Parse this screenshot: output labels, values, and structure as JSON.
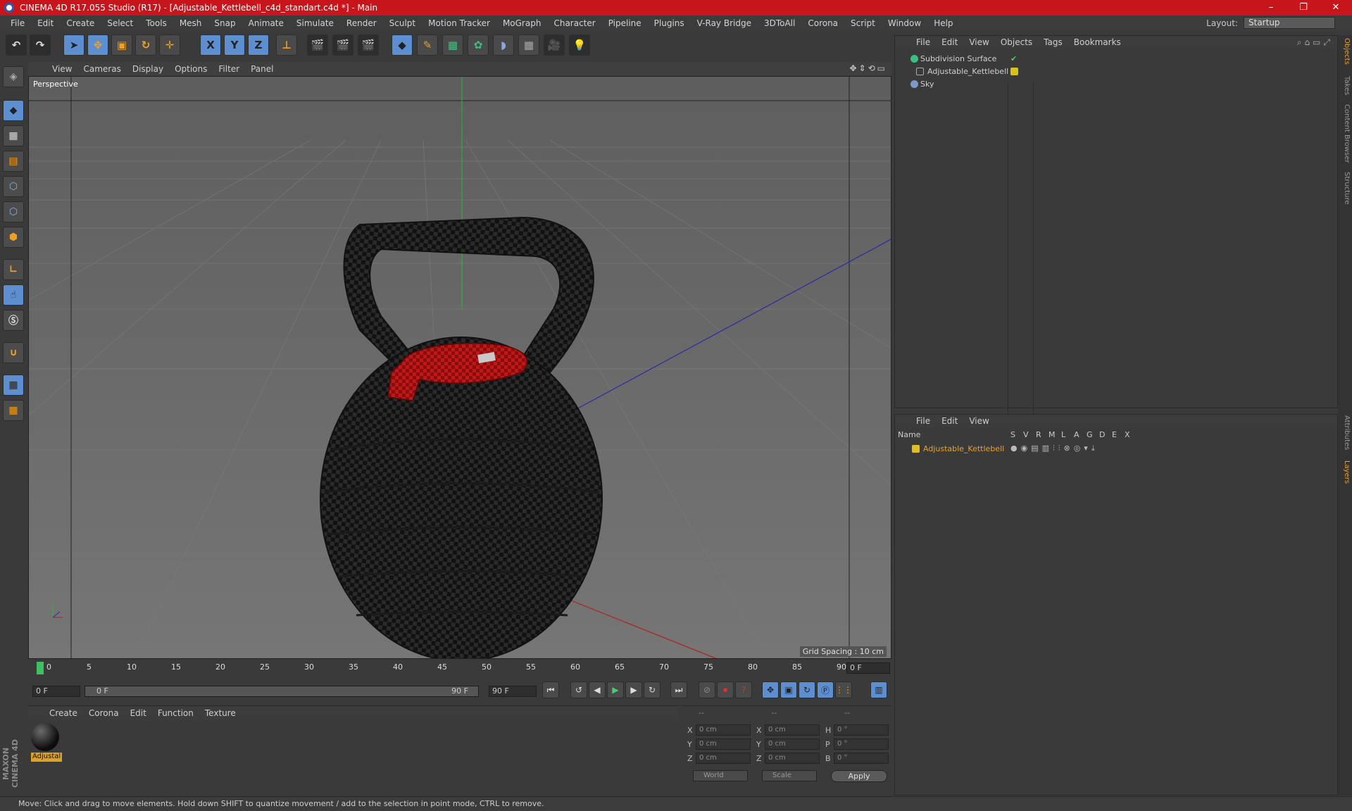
{
  "window": {
    "title": "CINEMA 4D R17.055 Studio (R17) - [Adjustable_Kettlebell_c4d_standart.c4d *] - Main",
    "controls": [
      "–",
      "❐",
      "✕"
    ]
  },
  "menubar": {
    "items": [
      "File",
      "Edit",
      "Create",
      "Select",
      "Tools",
      "Mesh",
      "Snap",
      "Animate",
      "Simulate",
      "Render",
      "Sculpt",
      "Motion Tracker",
      "MoGraph",
      "Character",
      "Pipeline",
      "Plugins",
      "V-Ray Bridge",
      "3DToAll",
      "Corona",
      "Script",
      "Window",
      "Help"
    ],
    "layout_label": "Layout:",
    "layout_value": "Startup"
  },
  "toolbar": {
    "axis_x": "X",
    "axis_y": "Y",
    "axis_z": "Z"
  },
  "viewport": {
    "menu": [
      "View",
      "Cameras",
      "Display",
      "Options",
      "Filter",
      "Panel"
    ],
    "label": "Perspective",
    "grid_spacing": "Grid Spacing : 10 cm"
  },
  "timeline": {
    "ticks": [
      "0",
      "5",
      "10",
      "15",
      "20",
      "25",
      "30",
      "35",
      "40",
      "45",
      "50",
      "55",
      "60",
      "65",
      "70",
      "75",
      "80",
      "85",
      "90"
    ],
    "current_frame": "0 F",
    "start_field": "0 F",
    "slider_start": "0 F",
    "slider_end": "90 F",
    "end_field": "90 F"
  },
  "material_manager": {
    "menu": [
      "Create",
      "Corona",
      "Edit",
      "Function",
      "Texture"
    ],
    "material_name": "Adjustal"
  },
  "coordinates": {
    "header": [
      "--",
      "--",
      "--"
    ],
    "rows": [
      {
        "l1": "X",
        "v1": "0 cm",
        "l2": "X",
        "v2": "0 cm",
        "l3": "H",
        "v3": "0 °"
      },
      {
        "l1": "Y",
        "v1": "0 cm",
        "l2": "Y",
        "v2": "0 cm",
        "l3": "P",
        "v3": "0 °"
      },
      {
        "l1": "Z",
        "v1": "0 cm",
        "l2": "Z",
        "v2": "0 cm",
        "l3": "B",
        "v3": "0 °"
      }
    ],
    "mode": "World",
    "scale": "Scale",
    "apply": "Apply"
  },
  "object_manager": {
    "menu": [
      "File",
      "Edit",
      "View",
      "Objects",
      "Tags",
      "Bookmarks"
    ],
    "objects": [
      {
        "name": "Subdivision Surface",
        "color": "#3fbf7f"
      },
      {
        "name": "Adjustable_Kettlebell",
        "color": "#d6c21a"
      },
      {
        "name": "Sky",
        "color": "#7a9acb"
      }
    ]
  },
  "layer_manager": {
    "menu": [
      "File",
      "Edit",
      "View"
    ],
    "columns": [
      "Name",
      "S",
      "V",
      "R",
      "M",
      "L",
      "A",
      "G",
      "D",
      "E",
      "X"
    ],
    "layer_name": "Adjustable_Kettlebell",
    "layer_color": "#e0c020"
  },
  "side_tabs": [
    "Objects",
    "Takes",
    "Content Browser",
    "Structure",
    "Attributes",
    "Layers"
  ],
  "status": "Move: Click and drag to move elements. Hold down SHIFT to quantize movement / add to the selection in point mode, CTRL to remove.",
  "brand": "MAXON CINEMA 4D"
}
